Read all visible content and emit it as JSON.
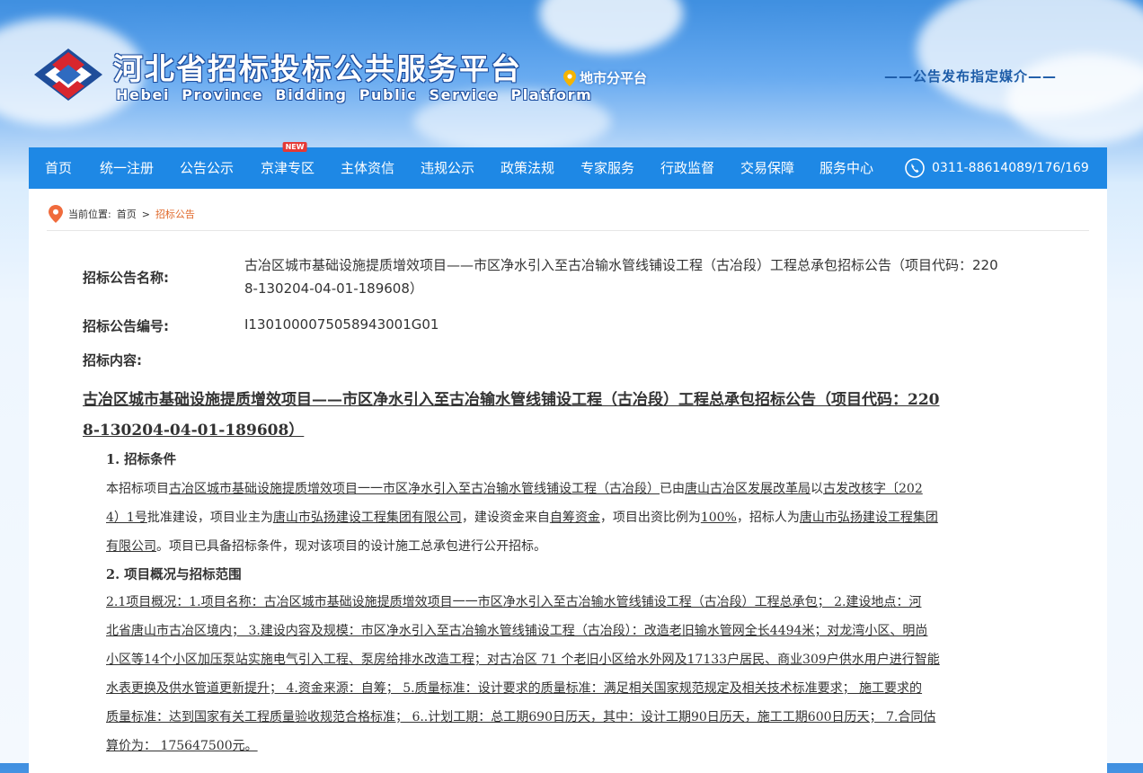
{
  "header": {
    "title": "河北省招标投标公共服务平台",
    "subtitle": "Hebei Province Bidding Public Service Platform",
    "city_link": "地市分平台",
    "slogan": "——公告发布指定媒介——"
  },
  "nav": {
    "items": [
      "首页",
      "统一注册",
      "公告公示",
      "京津专区",
      "主体资信",
      "违规公示",
      "政策法规",
      "专家服务",
      "行政监督",
      "交易保障",
      "服务中心"
    ],
    "new_badge": "NEW",
    "phone": "0311-88614089/176/169"
  },
  "breadcrumb": {
    "prefix": "当前位置:",
    "home": "首页",
    "sep": ">",
    "current": "招标公告"
  },
  "notice": {
    "name_label": "招标公告名称:",
    "name_value_line1": "古冶区城市基础设施提质增效项目——市区净水引入至古冶输水管线铺设工程（古冶段）工程总承包招标公告（项目代码：220",
    "name_value_line2": "8-130204-04-01-189608）",
    "code_label": "招标公告编号:",
    "code_value": "I1301000075058943001G01",
    "content_label": "招标内容:"
  },
  "doc": {
    "title_line1": "古冶区城市基础设施提质增效项目——市区净水引入至古冶输水管线铺设工程（古冶段）工程总承包招标公告（项目代码：220",
    "title_line2": "8-130204-04-01-189608）",
    "sec1_title": "1. 招标条件",
    "sec1_p1_a": "本招标项目",
    "sec1_p1_b": "古冶区城市基础设施提质增效项目一一市区净水引入至古冶输水管线铺设工程（古冶段）",
    "sec1_p1_c": "已由",
    "sec1_p1_d": "唐山古冶区发展改革局",
    "sec1_p1_e": "以",
    "sec1_p1_f": "古发改核字〔202",
    "sec1_p2_a": "4）1号",
    "sec1_p2_b": "批准建设，项目业主为",
    "sec1_p2_c": "唐山市弘扬建设工程集团有限公司",
    "sec1_p2_d": "，建设资金来自",
    "sec1_p2_e": "自筹资金",
    "sec1_p2_f": "，项目出资比例为",
    "sec1_p2_g": "100%",
    "sec1_p2_h": "，招标人为",
    "sec1_p2_i": "唐山市弘扬建设工程集团",
    "sec1_p3_a": "有限公司",
    "sec1_p3_b": "。项目已具备招标条件，现对该项目的设计施工总承包进行公开招标。",
    "sec2_title": "2. 项目概况与招标范围",
    "sec2_l1": "2.1项目概况：1.项目名称：古冶区城市基础设施提质增效项目一一市区净水引入至古冶输水管线铺设工程（古冶段）工程总承包；  2.建设地点：河",
    "sec2_l2": "北省唐山市古冶区境内；  3.建设内容及规模：市区净水引入至古冶输水管线铺设工程（古冶段）：改造老旧输水管网全长4494米；对龙湾小区、明尚",
    "sec2_l3": "小区等14个小区加压泵站实施电气引入工程、泵房给排水改造工程；对古冶区 71 个老旧小区给水外网及17133户居民、商业309户供水用户进行智能",
    "sec2_l4": "水表更换及供水管道更新提升；  4.资金来源：自筹；  5.质量标准：设计要求的质量标准：满足相关国家规范规定及相关技术标准要求；  施工要求的",
    "sec2_l5": "质量标准：达到国家有关工程质量验收规范合格标准；  6..计划工期：总工期690日历天，其中：设计工期90日历天，施工工期600日历天；  7.合同估",
    "sec2_l6": "算价为：  175647500元。"
  },
  "colors": {
    "nav_bg": "#1e88e5",
    "breadcrumb_active": "#e06a2c",
    "slogan": "#1d5ca8"
  }
}
